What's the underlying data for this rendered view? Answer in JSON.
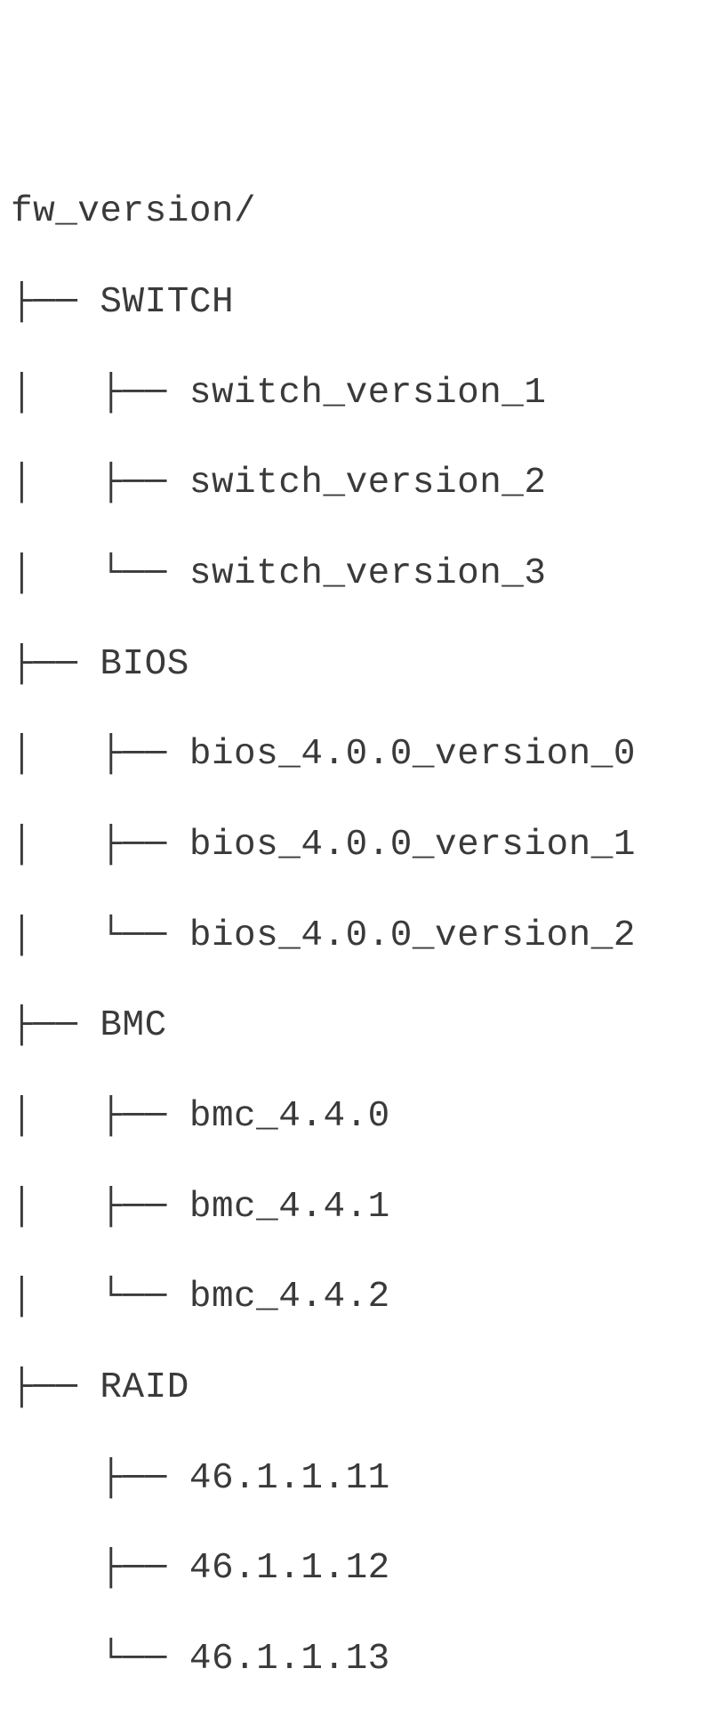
{
  "tree": {
    "root": "fw_version/",
    "nodes": [
      {
        "name": "SWITCH",
        "children": [
          "switch_version_1",
          "switch_version_2",
          "switch_version_3"
        ]
      },
      {
        "name": "BIOS",
        "children": [
          "bios_4.0.0_version_0",
          "bios_4.0.0_version_1",
          "bios_4.0.0_version_2"
        ]
      },
      {
        "name": "BMC",
        "children": [
          "bmc_4.4.0",
          "bmc_4.4.1",
          "bmc_4.4.2"
        ]
      },
      {
        "name": "RAID",
        "children": [
          "46.1.1.11",
          "46.1.1.12",
          "46.1.1.13"
        ]
      }
    ]
  },
  "glyphs": {
    "branch": "├── ",
    "last": "└── ",
    "pipe": "│   ",
    "space": "    "
  }
}
